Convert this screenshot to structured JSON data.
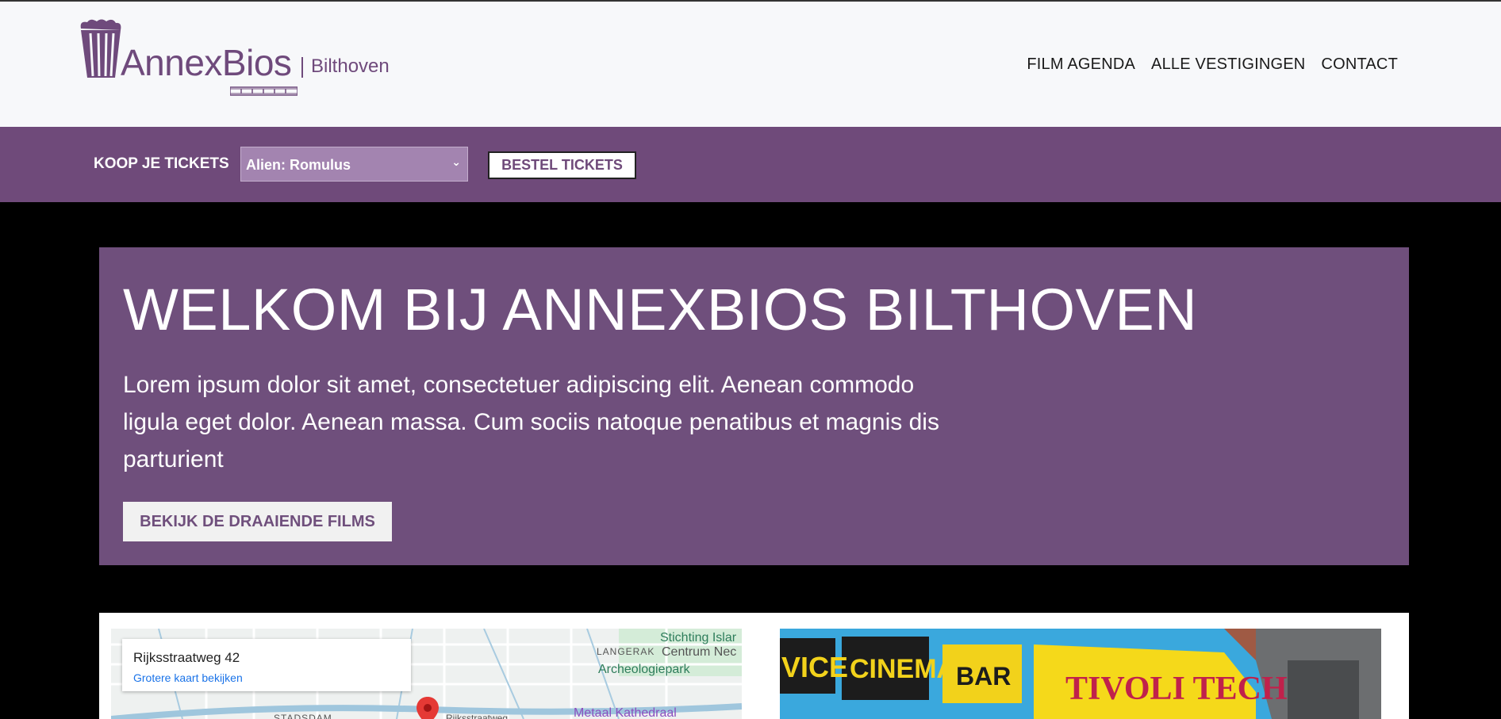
{
  "header": {
    "brand": "AnnexBios",
    "location": "Bilthoven",
    "nav": [
      "FILM AGENDA",
      "ALLE VESTIGINGEN",
      "CONTACT"
    ]
  },
  "ticket_bar": {
    "label": "KOOP JE TICKETS",
    "selected_film": "Alien: Romulus",
    "order_button": "BESTEL TICKETS"
  },
  "hero": {
    "title": "WELKOM BIJ ANNEXBIOS BILTHOVEN",
    "text": "Lorem ipsum dolor sit amet, consectetuer adipiscing elit. Aenean commodo ligula eget dolor. Aenean massa. Cum sociis natoque penatibus et magnis dis parturient",
    "cta": "BEKIJK DE DRAAIENDE FILMS"
  },
  "map": {
    "address": "Rijksstraatweg 42",
    "larger_map_link": "Grotere kaart bekijken",
    "places": {
      "stichting": "Stichting Islar",
      "centrum": "Centrum Nec",
      "langerak": "LANGERAK",
      "archeologiepark": "Archeologiepark",
      "stadsdam": "STADSDAM",
      "street": "Rijksstraatweg",
      "metaal": "Metaal Kathedraal"
    }
  },
  "photo": {
    "signs": [
      "VICE",
      "CINEMA",
      "BAR",
      "TIVOLI TECH"
    ]
  },
  "colors": {
    "brand_purple": "#6f4a7a",
    "hero_purple": "#6f4f7c",
    "select_bg": "#a384b0",
    "link_blue": "#1a73e8",
    "marker_red": "#e53935"
  }
}
